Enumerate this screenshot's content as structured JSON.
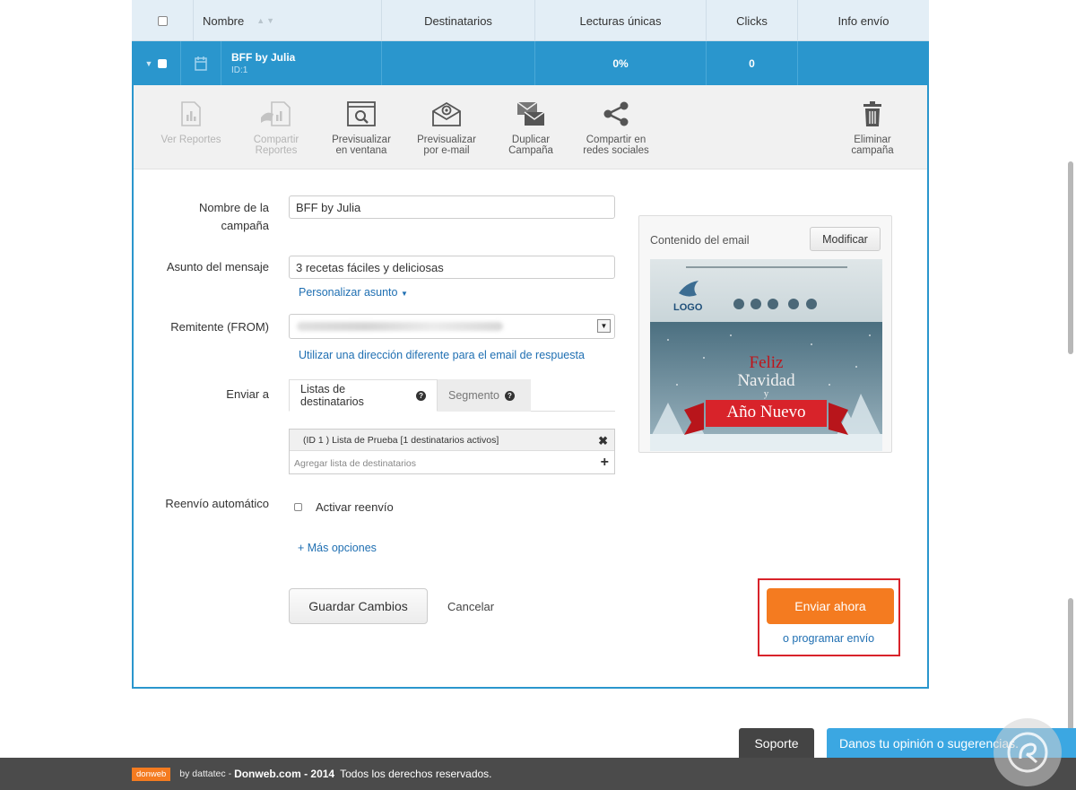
{
  "table": {
    "headers": [
      "Nombre",
      "Destinatarios",
      "Lecturas únicas",
      "Clicks",
      "Info envío"
    ],
    "row": {
      "name": "BFF by Julia",
      "id": "ID:1",
      "reads": "0%",
      "clicks": "0"
    }
  },
  "toolbar": {
    "ver_reportes": "Ver Reportes",
    "compartir_reportes": "Compartir\nReportes",
    "previsualizar_ventana": "Previsualizar\nen ventana",
    "previsualizar_email": "Previsualizar\npor e-mail",
    "duplicar": "Duplicar\nCampaña",
    "compartir_redes": "Compartir en\nredes sociales",
    "eliminar": "Eliminar\ncampaña"
  },
  "form": {
    "campaign_name_label_1": "Nombre de la",
    "campaign_name_label_2": "campaña",
    "campaign_name_value": "BFF by Julia",
    "subject_label": "Asunto del mensaje",
    "subject_value": "3 recetas fáciles y deliciosas",
    "personalize_link": "Personalizar asunto",
    "sender_label": "Remitente (FROM)",
    "reply_link": "Utilizar una dirección diferente para el email de respuesta",
    "send_to_label": "Enviar a",
    "tab_lists": "Listas de destinatarios",
    "tab_segment": "Segmento",
    "list_item": "(ID 1 ) Lista de Prueba [1 destinatarios activos]",
    "add_list": "Agregar lista de destinatarios",
    "forward_label": "Reenvío automático",
    "forward_checkbox": "Activar reenvío",
    "more_options": "+ Más opciones",
    "save": "Guardar Cambios",
    "cancel": "Cancelar",
    "send_now": "Enviar ahora",
    "schedule": "o programar envío"
  },
  "preview": {
    "title": "Contenido del email",
    "modify": "Modificar",
    "logo": "LOGO",
    "greeting_1": "Feliz",
    "greeting_2": "Navidad",
    "greeting_3": "y",
    "greeting_4": "Año Nuevo"
  },
  "footer": {
    "support": "Soporte",
    "opinion": "Danos tu opinión o sugerencias.",
    "brand": "donweb",
    "by": "by dattatec -",
    "site": "Donweb.com - 2014",
    "rights": "Todos los derechos reservados."
  },
  "colors": {
    "accent_blue": "#2a96cd",
    "send_orange": "#f47b20",
    "highlight_red": "#d8232a",
    "link_blue": "#1f6fb2"
  }
}
